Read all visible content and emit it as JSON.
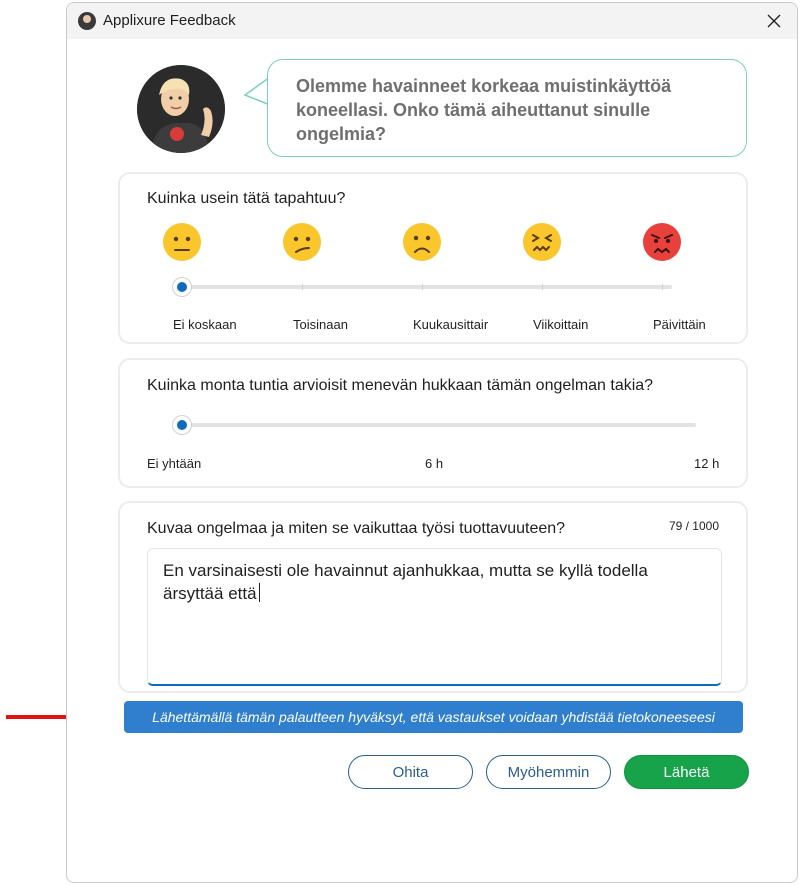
{
  "window": {
    "title": "Applixure Feedback"
  },
  "message": "Olemme havainneet korkeaa muistinkäyttöä koneellasi. Onko tämä aiheuttanut sinulle ongelmia?",
  "frequency": {
    "question": "Kuinka usein tätä tapahtuu?",
    "options": [
      {
        "label": "Ei koskaan",
        "icon": "neutral-face-icon"
      },
      {
        "label": "Toisinaan",
        "icon": "confused-face-icon"
      },
      {
        "label": "Kuukausittair",
        "icon": "frowning-face-icon"
      },
      {
        "label": "Viikoittain",
        "icon": "confounded-face-icon"
      },
      {
        "label": "Päivittäin",
        "icon": "angry-face-icon"
      }
    ],
    "selected_index": 0
  },
  "hours": {
    "question": "Kuinka monta tuntia arvioisit menevän hukkaan tämän ongelman takia?",
    "min_label": "Ei yhtään",
    "mid_label": "6 h",
    "max_label": "12 h",
    "value": 0
  },
  "description": {
    "question": "Kuvaa ongelmaa ja miten se vaikuttaa työsi tuottavuuteen?",
    "counter": "79 / 1000",
    "text": "En varsinaisesti ole havainnut ajanhukkaa, mutta se kyllä todella ärsyttää että"
  },
  "consent_notice": "Lähettämällä tämän palautteen hyväksyt, että vastaukset voidaan yhdistää tietokoneeseesi",
  "buttons": {
    "skip": "Ohita",
    "later": "Myöhemmin",
    "send": "Lähetä"
  },
  "colors": {
    "accent": "#0f6cbd",
    "send": "#16a34a",
    "banner": "#2f7fce",
    "annotation_arrow": "#e3140f"
  }
}
